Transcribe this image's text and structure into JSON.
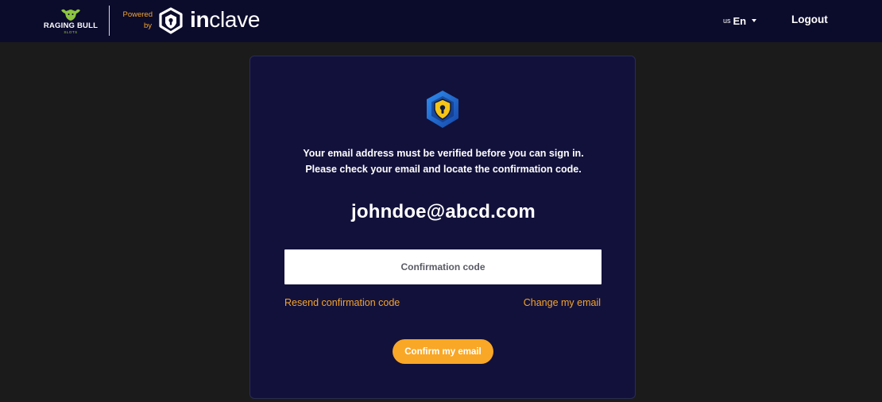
{
  "header": {
    "brand_name": "RAGING BULL",
    "brand_sub": "SLOTS",
    "powered_line1": "Powered",
    "powered_line2": "by",
    "inclave_prefix": "in",
    "inclave_suffix": "clave",
    "lang_country": "us",
    "lang_code": "En",
    "logout_label": "Logout"
  },
  "card": {
    "message_line1": "Your email address must be verified before you can sign in.",
    "message_line2": "Please check your email and locate the confirmation code.",
    "email": "johndoe@abcd.com",
    "code_placeholder": "Confirmation code",
    "resend_label": "Resend confirmation code",
    "change_label": "Change my email",
    "confirm_label": "Confirm my email"
  },
  "colors": {
    "header_bg": "#0b0b2c",
    "page_bg": "#1b1b1b",
    "card_bg": "#12113b",
    "accent_orange": "#f9a726",
    "link_orange": "#f5a52a",
    "shield_blue": "#1f6fd6",
    "shield_yellow": "#f5c518"
  },
  "icons": {
    "brand": "raging-bull-logo-icon",
    "inclave": "inclave-shield-icon",
    "lang_caret": "caret-down-icon",
    "security": "shield-lock-icon"
  }
}
